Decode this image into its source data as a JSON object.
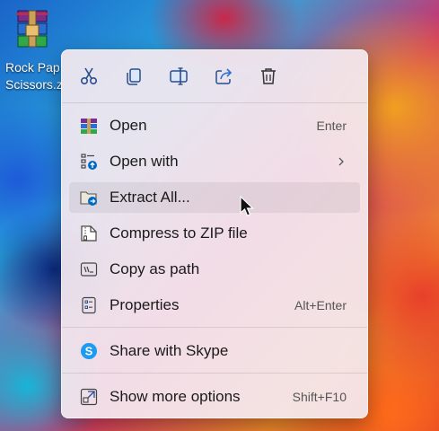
{
  "desktop": {
    "icon_label": "Rock Pap\nScissors.z"
  },
  "toolbar": {
    "buttons": [
      {
        "name": "cut-icon",
        "label": "Cut"
      },
      {
        "name": "copy-icon",
        "label": "Copy"
      },
      {
        "name": "rename-icon",
        "label": "Rename"
      },
      {
        "name": "share-icon",
        "label": "Share"
      },
      {
        "name": "delete-icon",
        "label": "Delete"
      }
    ]
  },
  "menu": {
    "items": [
      {
        "label": "Open",
        "shortcut": "Enter",
        "icon": "winrar-icon"
      },
      {
        "label": "Open with",
        "shortcut": "",
        "icon": "open-with-icon",
        "submenu": true
      },
      {
        "label": "Extract All...",
        "shortcut": "",
        "icon": "extract-folder-icon",
        "hover": true
      },
      {
        "label": "Compress to ZIP file",
        "shortcut": "",
        "icon": "zip-icon"
      },
      {
        "label": "Copy as path",
        "shortcut": "",
        "icon": "copy-path-icon"
      },
      {
        "label": "Properties",
        "shortcut": "Alt+Enter",
        "icon": "properties-icon"
      },
      {
        "label": "Share with Skype",
        "shortcut": "",
        "icon": "skype-icon"
      },
      {
        "label": "Show more options",
        "shortcut": "Shift+F10",
        "icon": "more-options-icon"
      }
    ]
  },
  "colors": {
    "accent": "#0067c0",
    "menu_bg": "#f4eaf0",
    "skype": "#1d9bf0"
  }
}
